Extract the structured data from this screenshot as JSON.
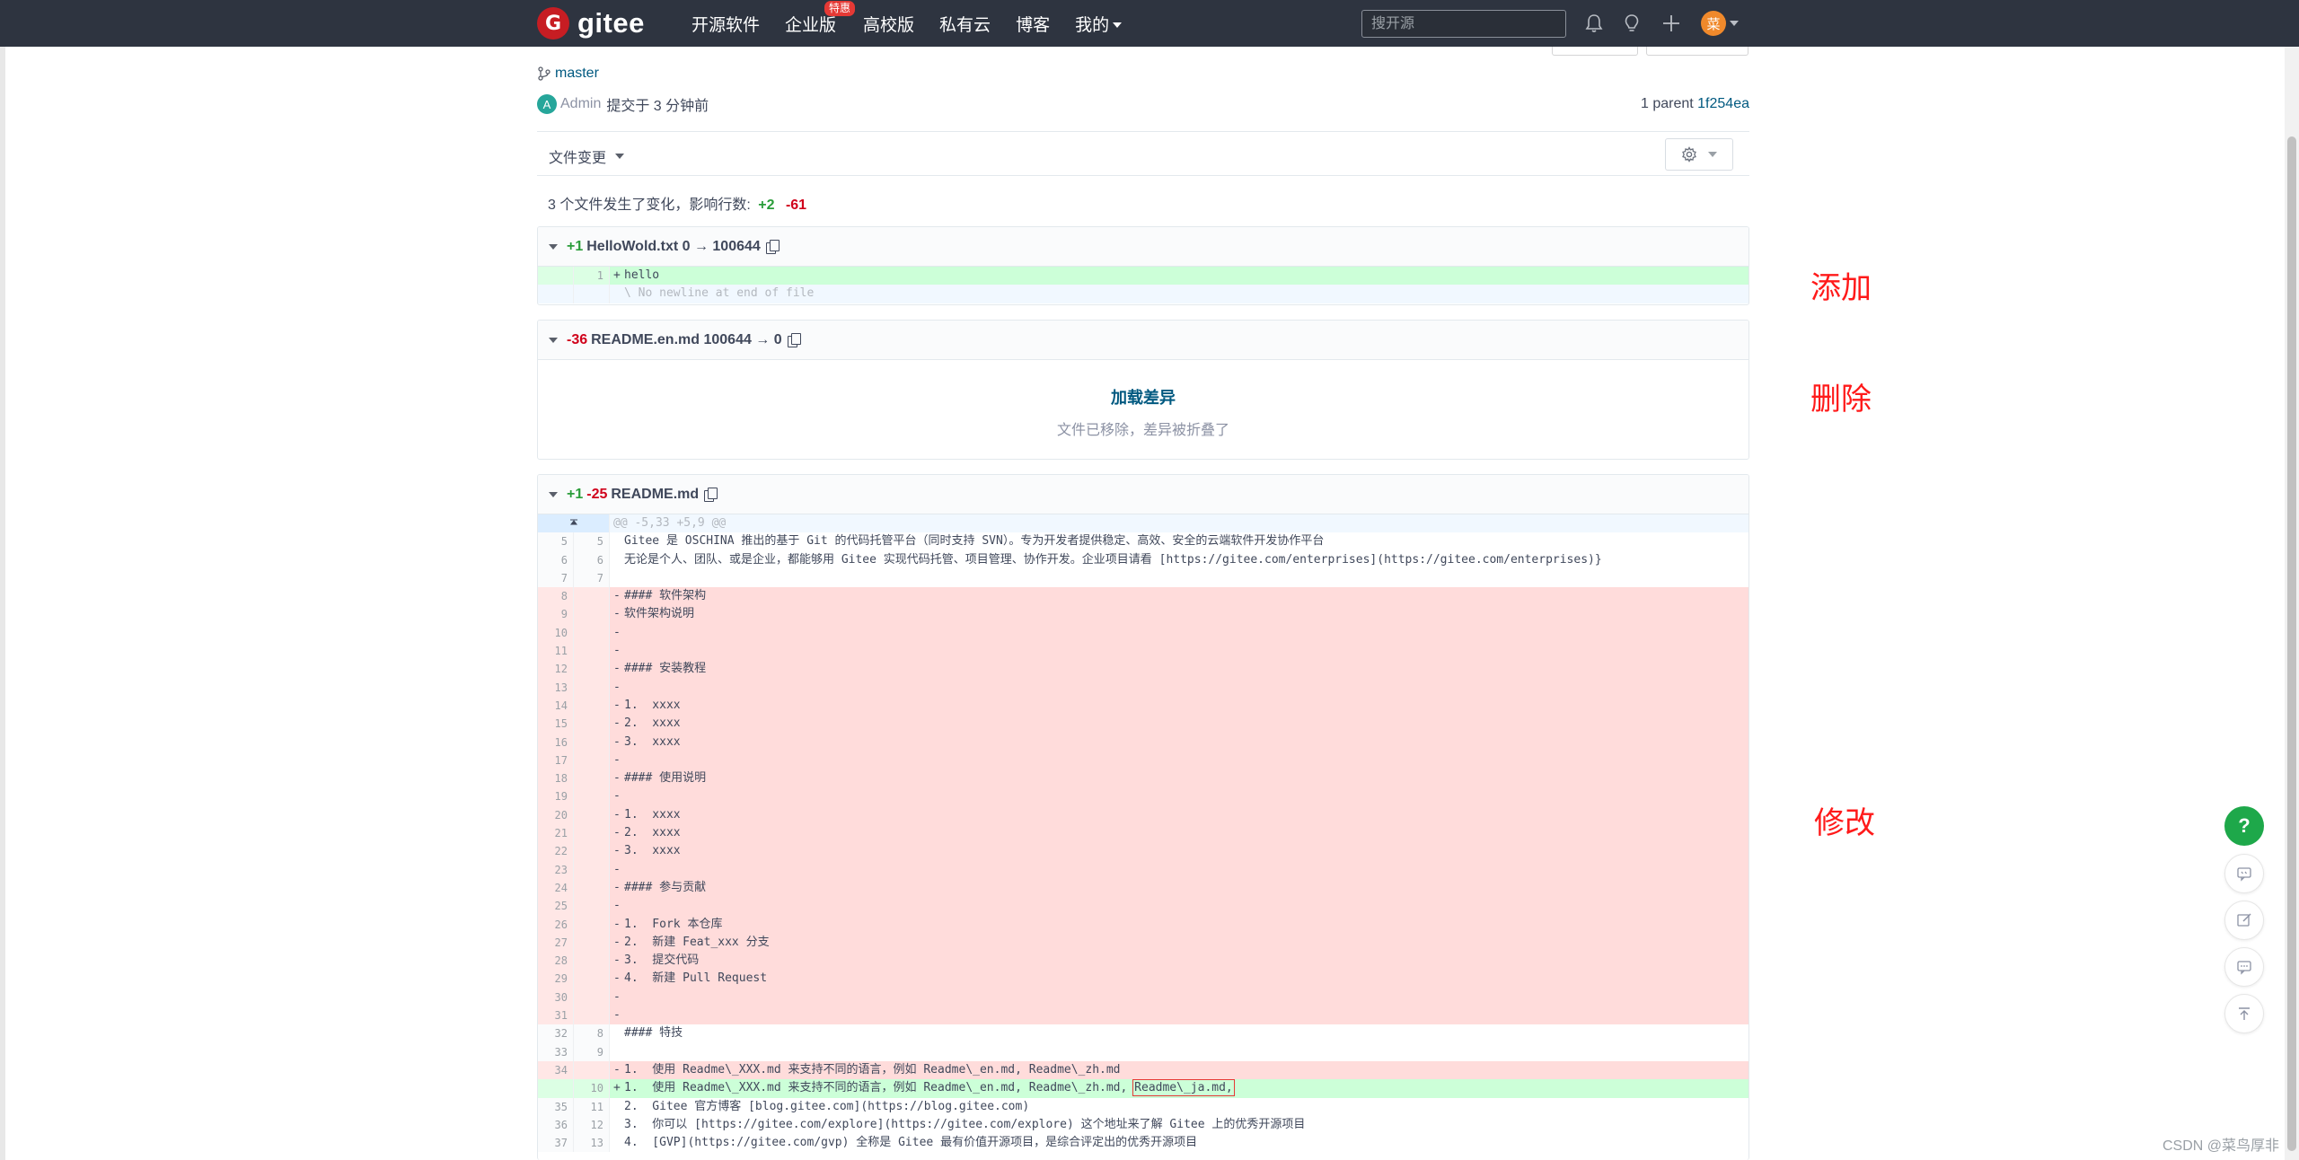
{
  "nav": {
    "brand": "gitee",
    "brand_logo": "G",
    "items": [
      "开源软件",
      "企业版",
      "高校版",
      "私有云",
      "博客",
      "我的"
    ],
    "hot_badge": "特惠",
    "search_placeholder": "搜开源",
    "user_avatar": "菜"
  },
  "commit": {
    "branch": "master",
    "author_avatar": "A",
    "author": "Admin",
    "message": "提交于 3 分钟前",
    "parent_label": "1 parent",
    "parent_sha": "1f254ea"
  },
  "toolbar": {
    "file_changes_label": "文件变更"
  },
  "summary": {
    "text": "3 个文件发生了变化，影响行数:",
    "additions": "+2",
    "deletions": "-61"
  },
  "files": [
    {
      "additions": "+1",
      "deletions": "",
      "name": "HelloWold.txt 0 → 100644",
      "lines": [
        {
          "type": "add",
          "old": "",
          "new": "1",
          "sign": "+",
          "text": "hello"
        },
        {
          "type": "meta",
          "old": "",
          "new": "",
          "sign": "",
          "text": "\\ No newline at end of file"
        }
      ]
    },
    {
      "additions": "",
      "deletions": "-36",
      "name": "README.en.md 100644 → 0",
      "load_diff": "加载差异",
      "note": "文件已移除，差异被折叠了"
    },
    {
      "additions": "+1",
      "deletions": "-25",
      "name": "README.md",
      "hunk_header": "@@ -5,33 +5,9 @@",
      "lines": [
        {
          "type": "ctx",
          "old": "5",
          "new": "5",
          "sign": "",
          "text": "Gitee 是 OSCHINA 推出的基于 Git 的代码托管平台（同时支持 SVN）。专为开发者提供稳定、高效、安全的云端软件开发协作平台"
        },
        {
          "type": "ctx",
          "old": "6",
          "new": "6",
          "sign": "",
          "text": "无论是个人、团队、或是企业，都能够用 Gitee 实现代码托管、项目管理、协作开发。企业项目请看 [https://gitee.com/enterprises](https://gitee.com/enterprises)}"
        },
        {
          "type": "ctx",
          "old": "7",
          "new": "7",
          "sign": "",
          "text": ""
        },
        {
          "type": "del",
          "old": "8",
          "new": "",
          "sign": "-",
          "text": "#### 软件架构"
        },
        {
          "type": "del",
          "old": "9",
          "new": "",
          "sign": "-",
          "text": "软件架构说明"
        },
        {
          "type": "del",
          "old": "10",
          "new": "",
          "sign": "-",
          "text": ""
        },
        {
          "type": "del",
          "old": "11",
          "new": "",
          "sign": "-",
          "text": ""
        },
        {
          "type": "del",
          "old": "12",
          "new": "",
          "sign": "-",
          "text": "#### 安装教程"
        },
        {
          "type": "del",
          "old": "13",
          "new": "",
          "sign": "-",
          "text": ""
        },
        {
          "type": "del",
          "old": "14",
          "new": "",
          "sign": "-",
          "text": "1.  xxxx"
        },
        {
          "type": "del",
          "old": "15",
          "new": "",
          "sign": "-",
          "text": "2.  xxxx"
        },
        {
          "type": "del",
          "old": "16",
          "new": "",
          "sign": "-",
          "text": "3.  xxxx"
        },
        {
          "type": "del",
          "old": "17",
          "new": "",
          "sign": "-",
          "text": ""
        },
        {
          "type": "del",
          "old": "18",
          "new": "",
          "sign": "-",
          "text": "#### 使用说明"
        },
        {
          "type": "del",
          "old": "19",
          "new": "",
          "sign": "-",
          "text": ""
        },
        {
          "type": "del",
          "old": "20",
          "new": "",
          "sign": "-",
          "text": "1.  xxxx"
        },
        {
          "type": "del",
          "old": "21",
          "new": "",
          "sign": "-",
          "text": "2.  xxxx"
        },
        {
          "type": "del",
          "old": "22",
          "new": "",
          "sign": "-",
          "text": "3.  xxxx"
        },
        {
          "type": "del",
          "old": "23",
          "new": "",
          "sign": "-",
          "text": ""
        },
        {
          "type": "del",
          "old": "24",
          "new": "",
          "sign": "-",
          "text": "#### 参与贡献"
        },
        {
          "type": "del",
          "old": "25",
          "new": "",
          "sign": "-",
          "text": ""
        },
        {
          "type": "del",
          "old": "26",
          "new": "",
          "sign": "-",
          "text": "1.  Fork 本仓库"
        },
        {
          "type": "del",
          "old": "27",
          "new": "",
          "sign": "-",
          "text": "2.  新建 Feat_xxx 分支"
        },
        {
          "type": "del",
          "old": "28",
          "new": "",
          "sign": "-",
          "text": "3.  提交代码"
        },
        {
          "type": "del",
          "old": "29",
          "new": "",
          "sign": "-",
          "text": "4.  新建 Pull Request"
        },
        {
          "type": "del",
          "old": "30",
          "new": "",
          "sign": "-",
          "text": ""
        },
        {
          "type": "del",
          "old": "31",
          "new": "",
          "sign": "-",
          "text": ""
        },
        {
          "type": "ctx",
          "old": "32",
          "new": "8",
          "sign": "",
          "text": "#### 特技"
        },
        {
          "type": "ctx",
          "old": "33",
          "new": "9",
          "sign": "",
          "text": ""
        },
        {
          "type": "del",
          "old": "34",
          "new": "",
          "sign": "-",
          "text": "1.  使用 Readme\\_XXX.md 来支持不同的语言，例如 Readme\\_en.md, Readme\\_zh.md"
        },
        {
          "type": "add",
          "old": "",
          "new": "10",
          "sign": "+",
          "text": "1.  使用 Readme\\_XXX.md 来支持不同的语言，例如 Readme\\_en.md, Readme\\_zh.md, ",
          "highlight": "Readme\\_ja.md,"
        },
        {
          "type": "ctx",
          "old": "35",
          "new": "11",
          "sign": "",
          "text": "2.  Gitee 官方博客 [blog.gitee.com](https://blog.gitee.com)"
        },
        {
          "type": "ctx",
          "old": "36",
          "new": "12",
          "sign": "",
          "text": "3.  你可以 [https://gitee.com/explore](https://gitee.com/explore) 这个地址来了解 Gitee 上的优秀开源项目"
        },
        {
          "type": "ctx",
          "old": "37",
          "new": "13",
          "sign": "",
          "text": "4.  [GVP](https://gitee.com/gvp) 全称是 Gitee 最有价值开源项目，是综合评定出的优秀开源项目"
        }
      ]
    }
  ],
  "annotations": {
    "added": "添加",
    "deleted": "删除",
    "modified": "修改"
  },
  "help_button": "?",
  "watermark": "CSDN @菜鸟厚非",
  "colors": {
    "navbar": "#2e3440",
    "add_bg": "#ccffd8",
    "del_bg": "#ffdcdb",
    "annotation": "#ff1a1a",
    "help": "#1ea84a"
  },
  "icons": [
    "bell-icon",
    "bulb-icon",
    "plus-icon",
    "branch-icon",
    "gear-icon",
    "copy-icon",
    "feedback-icon",
    "edit-icon",
    "message-icon",
    "back-to-top-icon"
  ]
}
